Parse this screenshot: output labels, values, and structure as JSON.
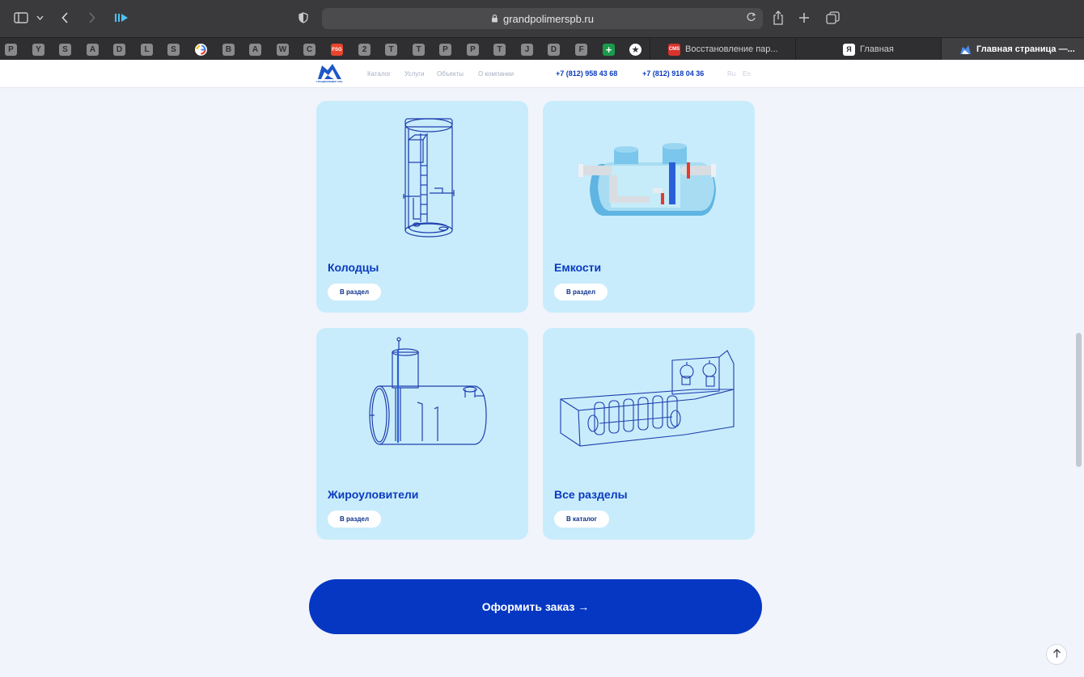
{
  "browser": {
    "url": "grandpolimerspb.ru",
    "bookmarks": [
      "P",
      "Y",
      "S",
      "A",
      "D",
      "L",
      "S",
      "G",
      "B",
      "A",
      "W",
      "C",
      "FSG",
      "2",
      "T",
      "T",
      "P",
      "P",
      "T",
      "J",
      "D",
      "F",
      "+",
      "★"
    ],
    "tabs": [
      {
        "label": "Восстановление пар...",
        "icon": "CMS"
      },
      {
        "label": "Главная",
        "icon": "Я"
      },
      {
        "label": "Главная страница —...",
        "icon": ""
      }
    ]
  },
  "header": {
    "logo_text": "ГРАНДПОЛИМЕР СПБ",
    "nav": [
      "Каталог",
      "Услуги",
      "Объекты",
      "О компании"
    ],
    "phones": [
      "+7 (812) 958 43 68",
      "+7 (812) 918 04 36"
    ],
    "languages": [
      "Ru",
      "En"
    ]
  },
  "cards": [
    {
      "title": "Колодцы",
      "button": "В раздел",
      "icon": "well-drawing-icon"
    },
    {
      "title": "Емкости",
      "button": "В раздел",
      "icon": "tank-3d-icon"
    },
    {
      "title": "Жироуловители",
      "button": "В раздел",
      "icon": "grease-trap-drawing-icon"
    },
    {
      "title": "Все разделы",
      "button": "В каталог",
      "icon": "treatment-plant-drawing-icon"
    }
  ],
  "order_button": "Оформить заказ →",
  "colors": {
    "primary": "#0537c3",
    "card_bg": "#c8ecfb",
    "title": "#0a3bbf",
    "line": "#1e3fae"
  }
}
